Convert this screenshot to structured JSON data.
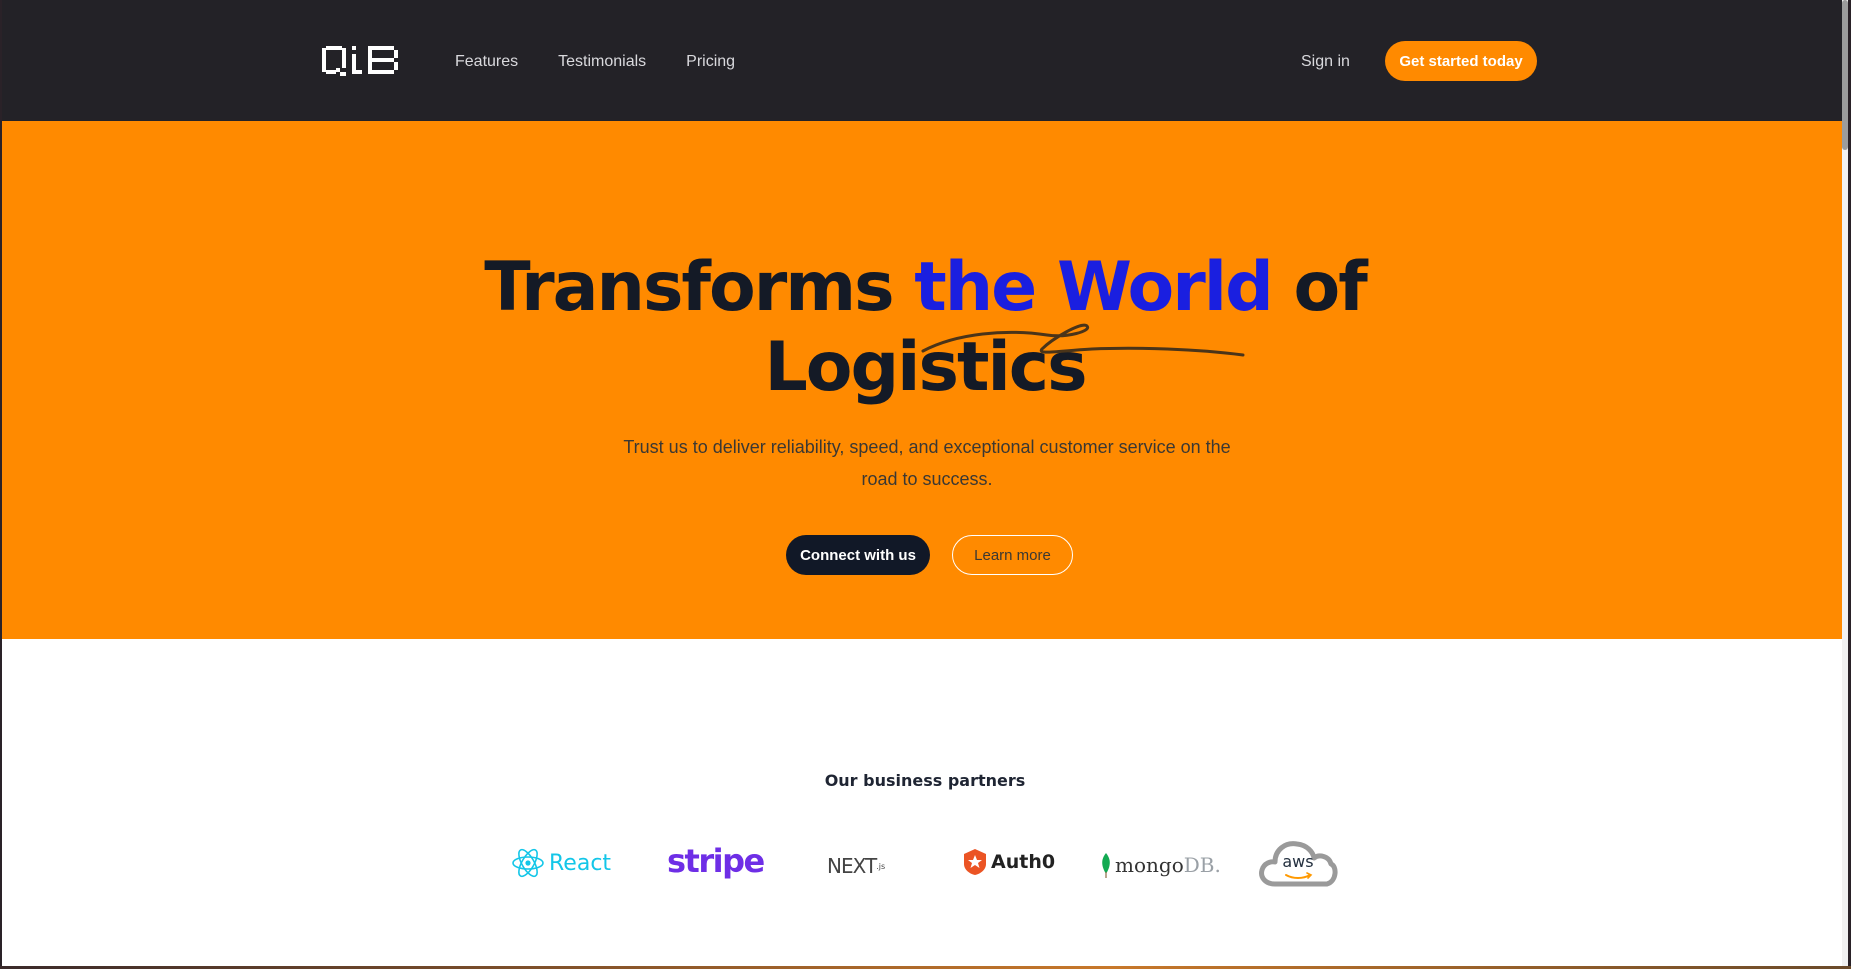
{
  "header": {
    "logo_alt": "QiB",
    "nav": [
      {
        "label": "Features"
      },
      {
        "label": "Testimonials"
      },
      {
        "label": "Pricing"
      }
    ],
    "signin_label": "Sign in",
    "cta_label": "Get started today"
  },
  "hero": {
    "headline_part1": "Transforms ",
    "headline_highlight": "the World",
    "headline_part2": " of",
    "headline_line2": "Logistics",
    "subtitle": "Trust us to deliver reliability, speed, and exceptional customer service on the road to success.",
    "primary_button": "Connect with us",
    "secondary_button": "Learn more"
  },
  "partners": {
    "title": "Our business partners",
    "logos": [
      {
        "name": "React",
        "text": "React",
        "icon": "react-atom-icon"
      },
      {
        "name": "Stripe",
        "text": "stripe"
      },
      {
        "name": "Next.js",
        "text": "NEXT",
        "suffix": ".js"
      },
      {
        "name": "Auth0",
        "text": "Auth0",
        "icon": "auth0-star-icon"
      },
      {
        "name": "MongoDB",
        "text": "mongo",
        "suffix": "DB.",
        "icon": "mongodb-leaf-icon"
      },
      {
        "name": "AWS",
        "text": "aws",
        "icon": "cloud-icon"
      }
    ]
  },
  "colors": {
    "header_bg": "#232227",
    "accent_orange": "#ff8a00",
    "highlight_blue": "#1a1fe0",
    "dark_text": "#141a26"
  }
}
